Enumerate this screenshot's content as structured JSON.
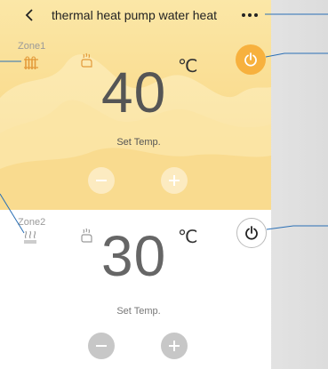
{
  "header": {
    "title": "thermal heat pump water heat"
  },
  "zone1": {
    "label": "Zone1",
    "temperature": "40",
    "unit": "℃",
    "set_label": "Set Temp.",
    "power": "on"
  },
  "zone2": {
    "label": "Zone2",
    "temperature": "30",
    "unit": "℃",
    "set_label": "Set Temp.",
    "power": "off"
  },
  "colors": {
    "accent": "#f7b13e",
    "panel_top": "#fbe7a7",
    "panel_bottom": "#f8d27a",
    "callout_line": "#2a6fb5"
  },
  "icons": [
    "back-arrow-icon",
    "more-dots-icon",
    "radiator-icon",
    "floor-heating-icon",
    "hand-heat-icon",
    "power-icon",
    "minus-icon",
    "plus-icon"
  ]
}
